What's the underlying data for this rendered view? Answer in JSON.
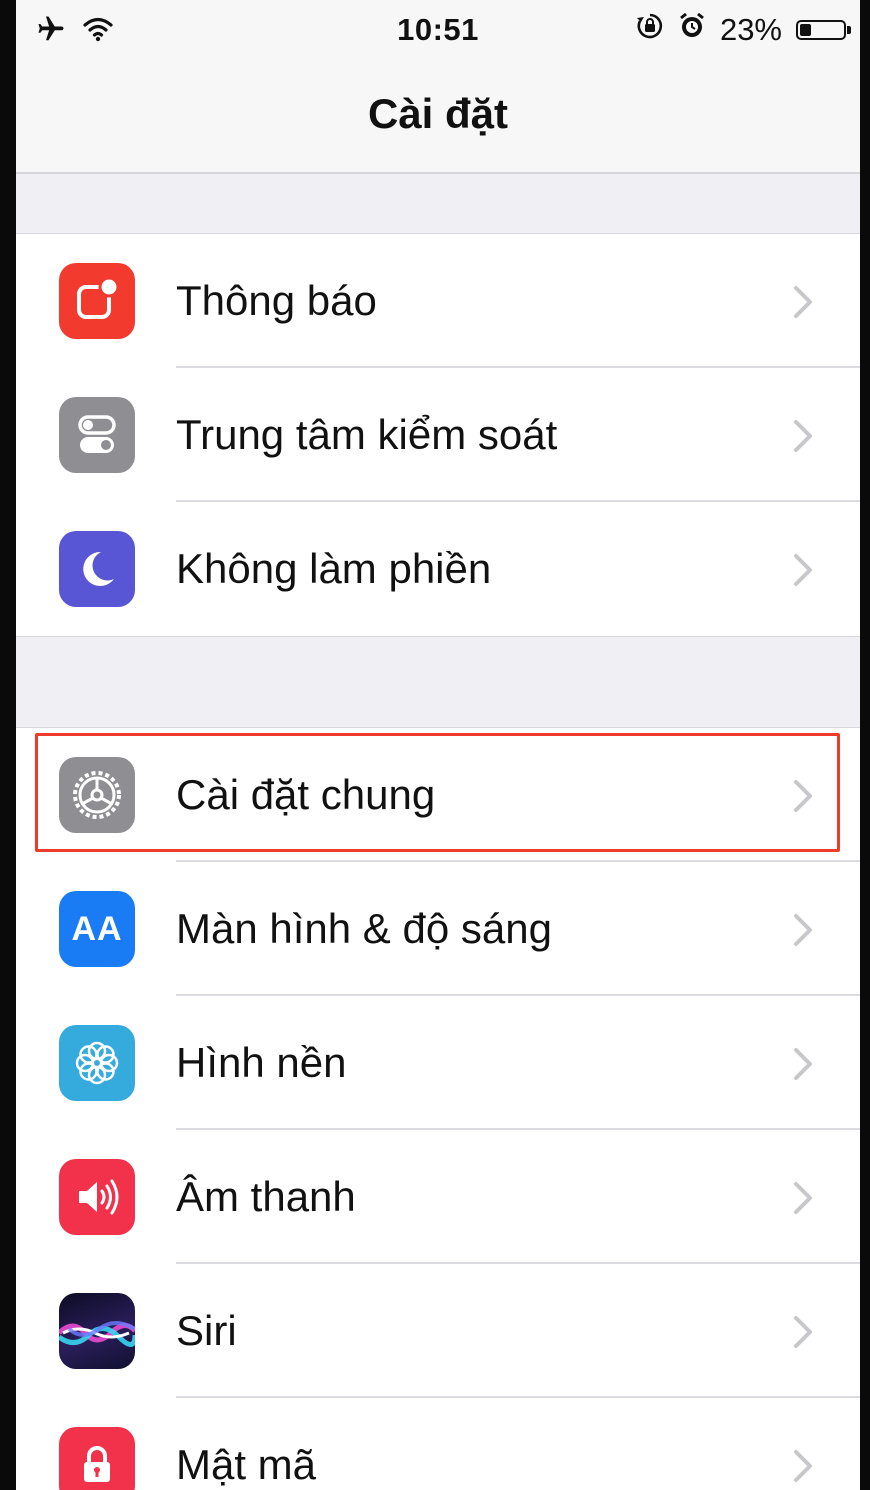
{
  "status_bar": {
    "time": "10:51",
    "battery_text": "23%",
    "battery_level": 0.23,
    "icons": [
      "airplane-icon",
      "wifi-icon",
      "rotation-lock-icon",
      "alarm-icon",
      "battery-icon"
    ]
  },
  "nav": {
    "title": "Cài đặt"
  },
  "groups": [
    {
      "items": [
        {
          "label": "Thông báo",
          "icon": "notifications-icon",
          "color": "#f23a2f"
        },
        {
          "label": "Trung tâm kiểm soát",
          "icon": "control-center-icon",
          "color": "#8e8e93"
        },
        {
          "label": "Không làm phiền",
          "icon": "moon-icon",
          "color": "#5956d6"
        }
      ]
    },
    {
      "items": [
        {
          "label": "Cài đặt chung",
          "icon": "gear-icon",
          "color": "#8e8e93",
          "highlighted": true
        },
        {
          "label": "Màn hình & độ sáng",
          "icon": "text-size-icon",
          "color": "#1a7cf5",
          "icon_text": "AA"
        },
        {
          "label": "Hình nền",
          "icon": "wallpaper-icon",
          "color": "#35aadc"
        },
        {
          "label": "Âm thanh",
          "icon": "speaker-icon",
          "color": "#f2324a"
        },
        {
          "label": "Siri",
          "icon": "siri-icon",
          "color": "#1a1a3a"
        },
        {
          "label": "Mật mã",
          "icon": "lock-icon",
          "color": "#f2324a"
        }
      ]
    }
  ],
  "colors": {
    "highlight": "#f03a2a",
    "background": "#efeff4",
    "chevron": "#c7c7cc"
  }
}
